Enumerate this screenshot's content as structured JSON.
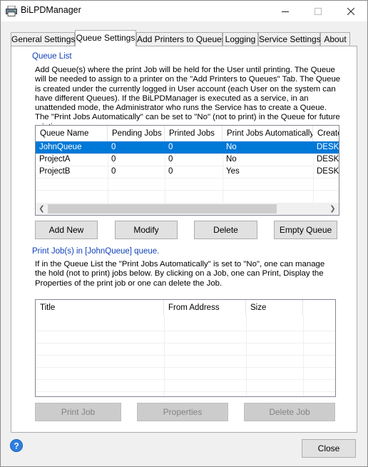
{
  "window": {
    "title": "BiLPDManager",
    "accent": "#0078d7"
  },
  "tabs": [
    {
      "label": "General Settings"
    },
    {
      "label": "Queue Settings"
    },
    {
      "label": "Add Printers to Queues"
    },
    {
      "label": "Logging"
    },
    {
      "label": "Service Settings"
    },
    {
      "label": "About"
    }
  ],
  "queue_list": {
    "label": "Queue List",
    "description": "Add Queue(s) where the print Job will be held for the User until printing. The Queue will be needed to assign to a printer on the \"Add Printers to Queues\" Tab. The Queue is created under the currently logged in User account (each User on the system can have different Queues). If the BiLPDManager is executed as a service, in an unattended mode, the Administrator who runs the Service has to create a Queue. The \"Print Jobs Automatically\" can be set to \"No\" (not to print) in the Queue for future printing.",
    "columns": [
      "Queue Name",
      "Pending Jobs",
      "Printed Jobs",
      "Print Jobs Automatically",
      "Created"
    ],
    "rows": [
      {
        "name": "JohnQueue",
        "pending": "0",
        "printed": "0",
        "auto": "No",
        "created": "DESKTOP",
        "selected": true
      },
      {
        "name": "ProjectA",
        "pending": "0",
        "printed": "0",
        "auto": "No",
        "created": "DESKTOP",
        "selected": false
      },
      {
        "name": "ProjectB",
        "pending": "0",
        "printed": "0",
        "auto": "Yes",
        "created": "DESKTOP",
        "selected": false
      }
    ],
    "buttons": {
      "add": "Add New",
      "modify": "Modify",
      "delete": "Delete",
      "empty": "Empty Queue"
    }
  },
  "print_jobs": {
    "label": "Print Job(s) in [JohnQueue] queue.",
    "description": "If in the Queue List the \"Print Jobs Automatically\" is set to \"No\", one can manage the hold (not to print) jobs below. By clicking on a Job, one can Print, Display the Properties of the print job or one can delete the Job.",
    "columns": [
      "Title",
      "From Address",
      "Size"
    ],
    "rows": [],
    "buttons": {
      "print": "Print Job",
      "properties": "Properties",
      "delete": "Delete Job"
    }
  },
  "footer": {
    "close": "Close"
  }
}
